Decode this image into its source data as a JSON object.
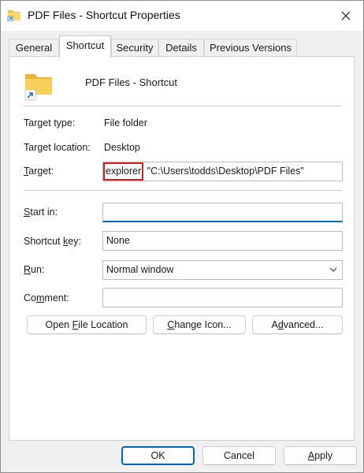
{
  "window": {
    "title": "PDF Files - Shortcut Properties"
  },
  "tabs": [
    {
      "label": "General",
      "active": false
    },
    {
      "label": "Shortcut",
      "active": true
    },
    {
      "label": "Security",
      "active": false
    },
    {
      "label": "Details",
      "active": false
    },
    {
      "label": "Previous Versions",
      "active": false
    }
  ],
  "shortcut": {
    "name": "PDF Files - Shortcut",
    "target_type_label": "Target type:",
    "target_type_value": "File folder",
    "target_location_label": "Target location:",
    "target_location_value": "Desktop",
    "target_label_prefix": "",
    "target_label_key": "T",
    "target_label_rest": "arget:",
    "target_exe": "explorer",
    "target_path": " \"C:\\Users\\todds\\Desktop\\PDF Files\"",
    "start_in_label_key": "S",
    "start_in_label_rest": "tart in:",
    "start_in_value": "",
    "shortcut_key_label_pre": "Shortcut ",
    "shortcut_key_label_key": "k",
    "shortcut_key_label_rest": "ey:",
    "shortcut_key_value": "None",
    "run_label_key": "R",
    "run_label_rest": "un:",
    "run_value": "Normal window",
    "comment_label_pre": "Co",
    "comment_label_key": "m",
    "comment_label_rest": "ment:",
    "comment_value": ""
  },
  "action_buttons": {
    "open_pre": "Open ",
    "open_key": "F",
    "open_rest": "ile Location",
    "change_key": "C",
    "change_rest": "hange Icon...",
    "advanced_pre": "A",
    "advanced_key": "d",
    "advanced_rest": "vanced..."
  },
  "dialog_buttons": {
    "ok": "OK",
    "cancel": "Cancel",
    "apply_key": "A",
    "apply_rest": "pply"
  },
  "colors": {
    "accent": "#0067c0",
    "highlight": "#d81e1e",
    "folder": "#f4c542"
  },
  "icons": [
    "folder-shortcut-icon",
    "close-icon",
    "chevron-down-icon"
  ]
}
